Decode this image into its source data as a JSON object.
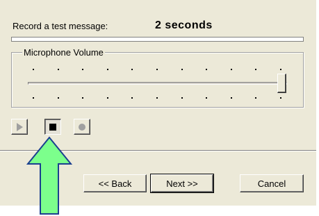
{
  "record_label": "Record a test message:",
  "duration": "2 seconds",
  "progress": 0,
  "group_title": "Microphone Volume",
  "volume_level": 1.0,
  "media_controls": [
    {
      "name": "play-icon",
      "state": "disabled"
    },
    {
      "name": "stop-icon",
      "state": "pressed"
    },
    {
      "name": "record-icon",
      "state": "disabled"
    }
  ],
  "buttons": {
    "back": "<< Back",
    "next": "Next >>",
    "cancel": "Cancel"
  },
  "colors": {
    "dialog_bg": "#ece9d8",
    "arrow_fill": "#7cff8c",
    "arrow_stroke": "#1a3f8f"
  }
}
